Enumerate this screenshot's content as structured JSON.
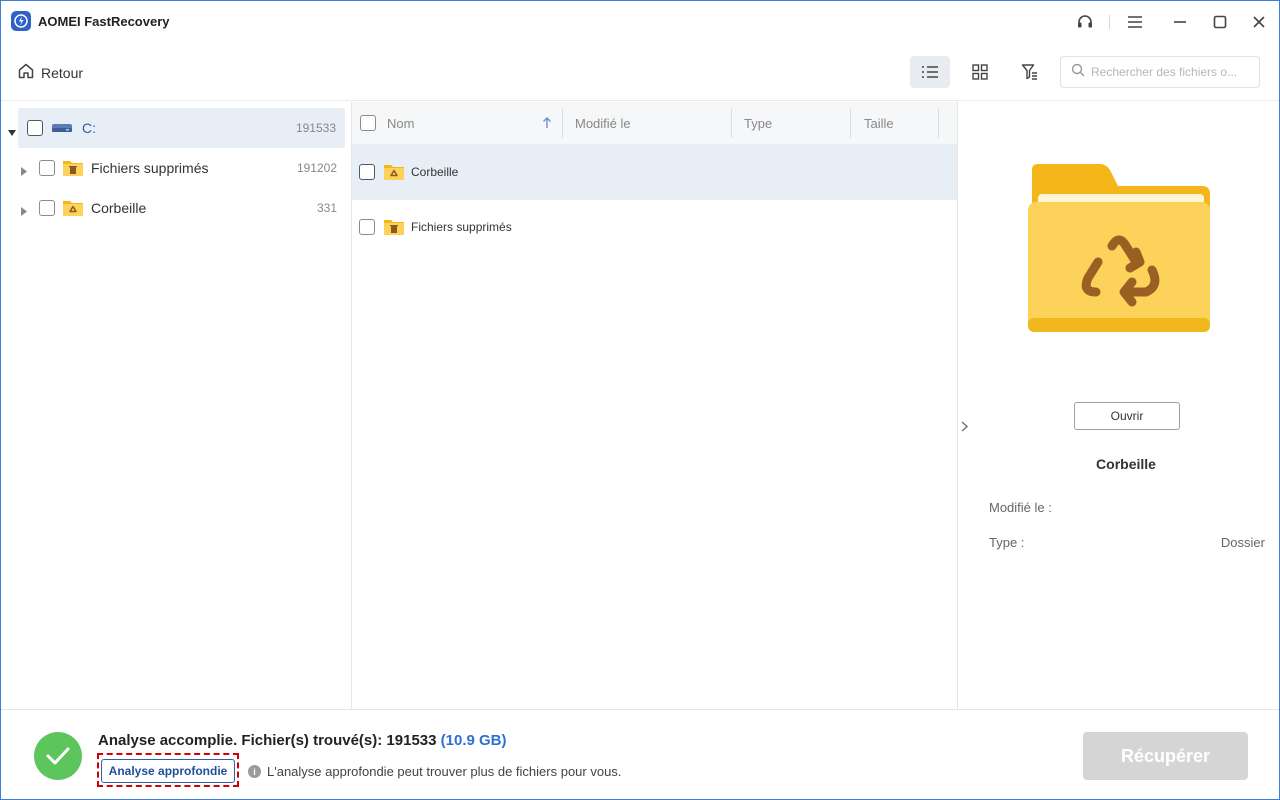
{
  "window": {
    "title": "AOMEI FastRecovery",
    "icons": [
      "app-logo-icon",
      "headset-icon",
      "menu-icon",
      "minimize-icon",
      "maximize-icon",
      "close-icon"
    ]
  },
  "toolbar": {
    "back_label": "Retour",
    "search_placeholder": "Rechercher des fichiers o...",
    "views": [
      "list-view",
      "grid-view",
      "filter"
    ]
  },
  "tree": {
    "items": [
      {
        "label": "C:",
        "count": "191533",
        "icon": "drive-icon",
        "selected": true,
        "expanded": true
      },
      {
        "label": "Fichiers supprimés",
        "count": "191202",
        "icon": "trash-folder-icon"
      },
      {
        "label": "Corbeille",
        "count": "331",
        "icon": "recycle-folder-icon"
      }
    ]
  },
  "list": {
    "columns": [
      "Nom",
      "Modifié le",
      "Type",
      "Taille"
    ],
    "sort": "Nom ascending",
    "rows": [
      {
        "name": "Corbeille",
        "icon": "recycle-folder-icon",
        "selected": true
      },
      {
        "name": "Fichiers supprimés",
        "icon": "trash-folder-icon",
        "selected": false
      }
    ]
  },
  "preview": {
    "open_label": "Ouvrir",
    "name": "Corbeille",
    "modified_key": "Modifié le :",
    "modified_value": "",
    "type_key": "Type :",
    "type_value": "Dossier"
  },
  "status": {
    "message": "Analyse accomplie. Fichier(s) trouvé(s): 191533",
    "size": "(10.9 GB)",
    "deep_scan_label": "Analyse approfondie",
    "hint": "L'analyse approfondie peut trouver plus de fichiers pour vous.",
    "recover_label": "Récupérer"
  },
  "colors": {
    "accent": "#2d62c8",
    "success": "#5cc55c",
    "selection": "#e8eef6",
    "folder": "#fcd25a",
    "highlight_border": "#d40000",
    "disabled_button": "#d5d5d5"
  }
}
